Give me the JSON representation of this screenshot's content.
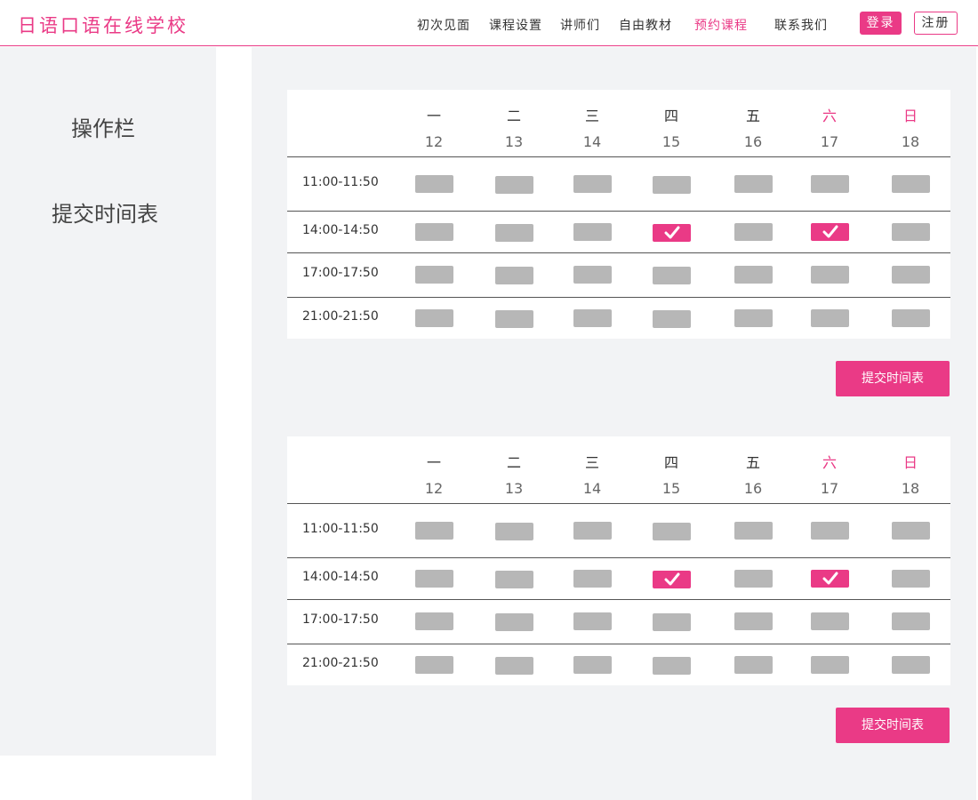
{
  "header": {
    "brand": "日语口语在线学校",
    "nav": [
      {
        "label": "初次见面",
        "active": false
      },
      {
        "label": "课程设置",
        "active": false
      },
      {
        "label": "讲师们",
        "active": false
      },
      {
        "label": "自由教材",
        "active": false
      },
      {
        "label": "预约课程",
        "active": true
      },
      {
        "label": "联系我们",
        "active": false
      }
    ],
    "login_label": "登录",
    "register_label": "注册"
  },
  "sidebar": {
    "title": "操作栏",
    "link": "提交时间表"
  },
  "schedules": [
    {
      "days": [
        {
          "label": "一",
          "date": "12",
          "weekend": false
        },
        {
          "label": "二",
          "date": "13",
          "weekend": false
        },
        {
          "label": "三",
          "date": "14",
          "weekend": false
        },
        {
          "label": "四",
          "date": "15",
          "weekend": false
        },
        {
          "label": "五",
          "date": "16",
          "weekend": false
        },
        {
          "label": "六",
          "date": "17",
          "weekend": true
        },
        {
          "label": "日",
          "date": "18",
          "weekend": true
        }
      ],
      "rows": [
        {
          "time": "11:00-11:50",
          "selected": [
            false,
            false,
            false,
            false,
            false,
            false,
            false
          ]
        },
        {
          "time": "14:00-14:50",
          "selected": [
            false,
            false,
            false,
            true,
            false,
            true,
            false
          ]
        },
        {
          "time": "17:00-17:50",
          "selected": [
            false,
            false,
            false,
            false,
            false,
            false,
            false
          ]
        },
        {
          "time": "21:00-21:50",
          "selected": [
            false,
            false,
            false,
            false,
            false,
            false,
            false
          ]
        }
      ],
      "submit_label": "提交时间表"
    },
    {
      "days": [
        {
          "label": "一",
          "date": "12",
          "weekend": false
        },
        {
          "label": "二",
          "date": "13",
          "weekend": false
        },
        {
          "label": "三",
          "date": "14",
          "weekend": false
        },
        {
          "label": "四",
          "date": "15",
          "weekend": false
        },
        {
          "label": "五",
          "date": "16",
          "weekend": false
        },
        {
          "label": "六",
          "date": "17",
          "weekend": true
        },
        {
          "label": "日",
          "date": "18",
          "weekend": true
        }
      ],
      "rows": [
        {
          "time": "11:00-11:50",
          "selected": [
            false,
            false,
            false,
            false,
            false,
            false,
            false
          ]
        },
        {
          "time": "14:00-14:50",
          "selected": [
            false,
            false,
            false,
            true,
            false,
            true,
            false
          ]
        },
        {
          "time": "17:00-17:50",
          "selected": [
            false,
            false,
            false,
            false,
            false,
            false,
            false
          ]
        },
        {
          "time": "21:00-21:50",
          "selected": [
            false,
            false,
            false,
            false,
            false,
            false,
            false
          ]
        }
      ],
      "submit_label": "提交时间表"
    }
  ],
  "colors": {
    "accent": "#ea3a86",
    "slot_empty": "#b7b7b7",
    "panel_bg": "#f2f3f5"
  },
  "icons": {
    "selected_slot": "checkmark-icon"
  }
}
